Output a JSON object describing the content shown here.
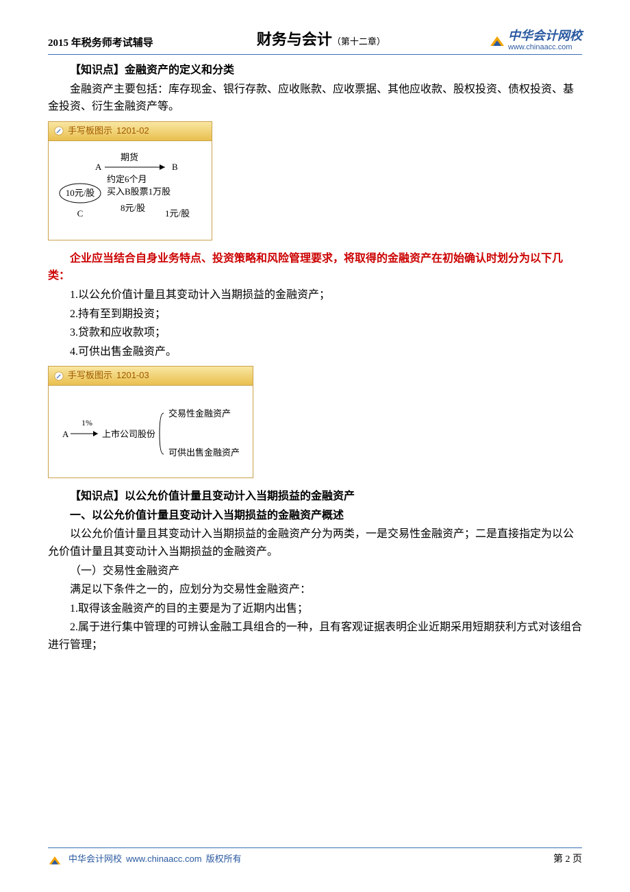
{
  "header": {
    "left": "2015 年税务师考试辅导",
    "center_title": "财务与会计",
    "chapter": "（第十二章）",
    "logo_cn": "中华会计网校",
    "logo_url": "www.chinaacc.com"
  },
  "section1": {
    "title": "【知识点】金融资产的定义和分类",
    "para": "金融资产主要包括：库存现金、银行存款、应收账款、应收票据、其他应收款、股权投资、债权投资、基金投资、衍生金融资产等。"
  },
  "diagram1": {
    "title_label": "手写板图示",
    "title_code": "1201-02",
    "A": "A",
    "B": "B",
    "C": "C",
    "futures": "期货",
    "line2": "约定6个月",
    "line3": "买入B股票1万股",
    "left_price": "10元/股",
    "p8": "8元/股",
    "p1": "1元/股"
  },
  "red_para": "企业应当结合自身业务特点、投资策略和风险管理要求，将取得的金融资产在初始确认时划分为以下几类：",
  "list1": {
    "i1": "1.以公允价值计量且其变动计入当期损益的金融资产；",
    "i2": "2.持有至到期投资；",
    "i3": "3.贷款和应收款项；",
    "i4": "4.可供出售金融资产。"
  },
  "diagram2": {
    "title_label": "手写板图示",
    "title_code": "1201-03",
    "A": "A",
    "percent": "1%",
    "listed": "上市公司股份",
    "opt1": "交易性金融资产",
    "opt2": "可供出售金融资产"
  },
  "section2": {
    "title": "【知识点】以公允价值计量且变动计入当期损益的金融资产",
    "subtitle": "一、以公允价值计量且变动计入当期损益的金融资产概述",
    "p1": "以公允价值计量且其变动计入当期损益的金融资产分为两类，一是交易性金融资产；二是直接指定为以公允价值计量且其变动计入当期损益的金融资产。",
    "p2": "（一）交易性金融资产",
    "p3": "满足以下条件之一的，应划分为交易性金融资产：",
    "p4": "1.取得该金融资产的目的主要是为了近期内出售；",
    "p5": "2.属于进行集中管理的可辨认金融工具组合的一种，且有客观证据表明企业近期采用短期获利方式对该组合进行管理；"
  },
  "footer": {
    "brand": "中华会计网校",
    "url": "www.chinaacc.com",
    "copyright": "版权所有",
    "page": "第 2 页"
  }
}
